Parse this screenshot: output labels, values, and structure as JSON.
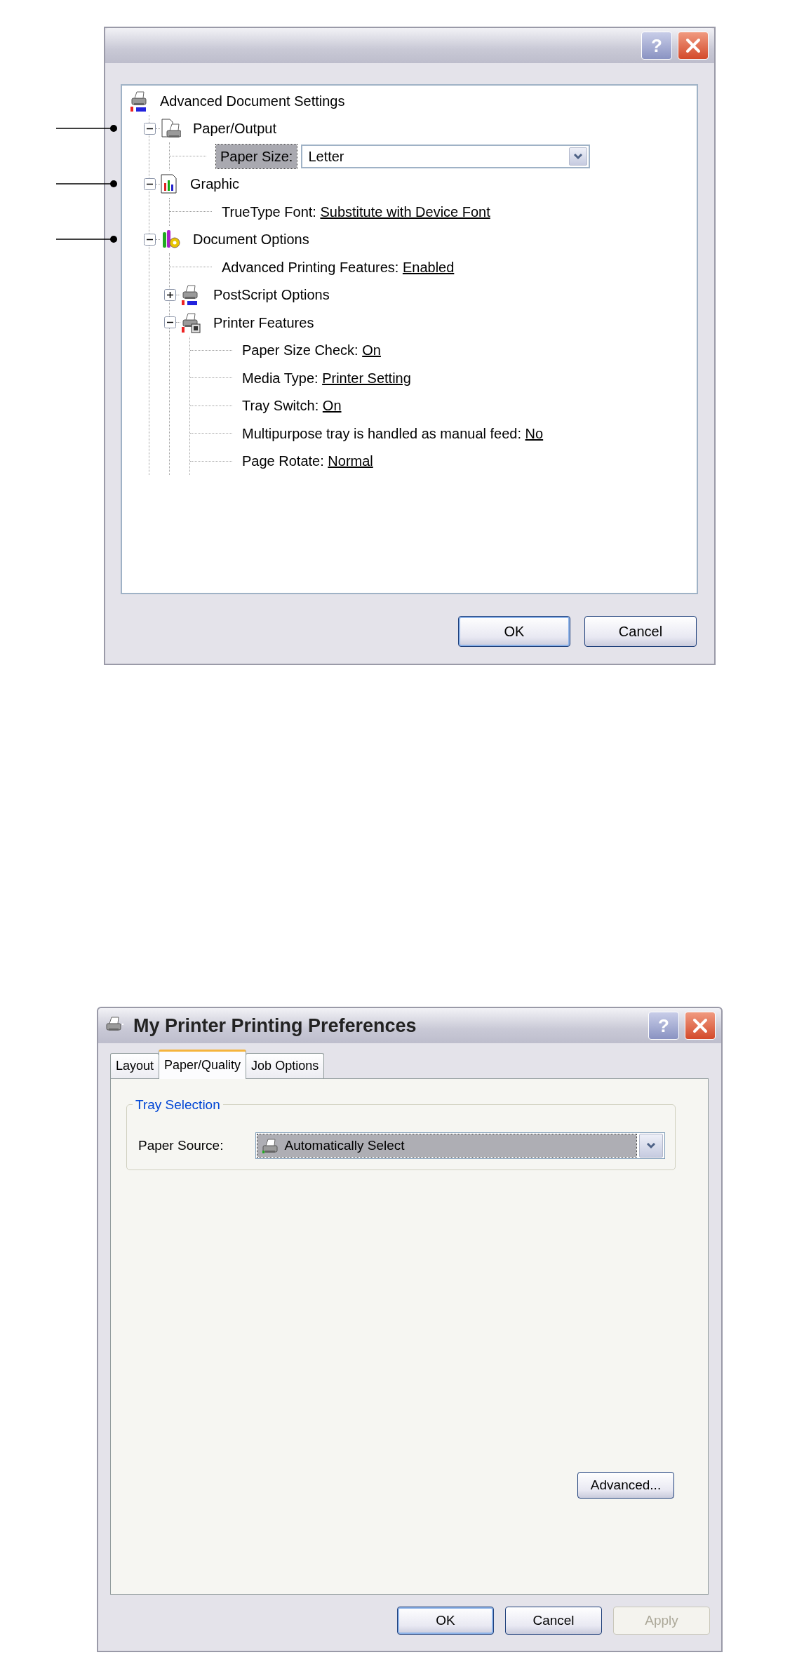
{
  "advanced_dialog": {
    "help_button": "?",
    "tree": {
      "label": "Advanced Document Settings",
      "kind": "root",
      "children": [
        {
          "label": "Paper/Output",
          "kind": "group",
          "expanded": true,
          "callout": true,
          "children": [
            {
              "label": "Paper Size:",
              "kind": "combo",
              "value": "Letter",
              "selected": true
            }
          ]
        },
        {
          "label": "Graphic",
          "kind": "group",
          "expanded": true,
          "callout": true,
          "children": [
            {
              "label": "TrueType Font:",
              "kind": "setting",
              "value": "Substitute with Device Font"
            }
          ]
        },
        {
          "label": "Document Options",
          "kind": "group",
          "expanded": true,
          "callout": true,
          "children": [
            {
              "label": "Advanced Printing Features:",
              "kind": "setting",
              "value": "Enabled"
            },
            {
              "label": "PostScript Options",
              "kind": "group",
              "expanded": false,
              "callout": false
            },
            {
              "label": "Printer Features",
              "kind": "group",
              "expanded": true,
              "callout": false,
              "children": [
                {
                  "label": "Paper Size Check:",
                  "kind": "setting",
                  "value": "On"
                },
                {
                  "label": "Media Type:",
                  "kind": "setting",
                  "value": "Printer Setting"
                },
                {
                  "label": "Tray Switch:",
                  "kind": "setting",
                  "value": "On"
                },
                {
                  "label": "Multipurpose tray is handled as manual feed:",
                  "kind": "setting",
                  "value": "No"
                },
                {
                  "label": "Page Rotate:",
                  "kind": "setting",
                  "value": "Normal"
                }
              ]
            }
          ]
        }
      ]
    },
    "buttons": [
      {
        "label": "OK",
        "default": true,
        "disabled": false
      },
      {
        "label": "Cancel",
        "default": false,
        "disabled": false
      }
    ]
  },
  "preferences_dialog": {
    "title": "My Printer Printing Preferences",
    "help_button": "?",
    "tabs": [
      {
        "label": "Layout",
        "selected": false
      },
      {
        "label": "Paper/Quality",
        "selected": true
      },
      {
        "label": "Job Options",
        "selected": false
      }
    ],
    "group": {
      "legend": "Tray Selection",
      "field": {
        "label": "Paper Source:",
        "value": "Automatically Select",
        "selected": true
      }
    },
    "advanced_button": "Advanced...",
    "buttons": [
      {
        "label": "OK",
        "default": true,
        "disabled": false
      },
      {
        "label": "Cancel",
        "default": false,
        "disabled": false
      },
      {
        "label": "Apply",
        "default": false,
        "disabled": true
      }
    ]
  }
}
